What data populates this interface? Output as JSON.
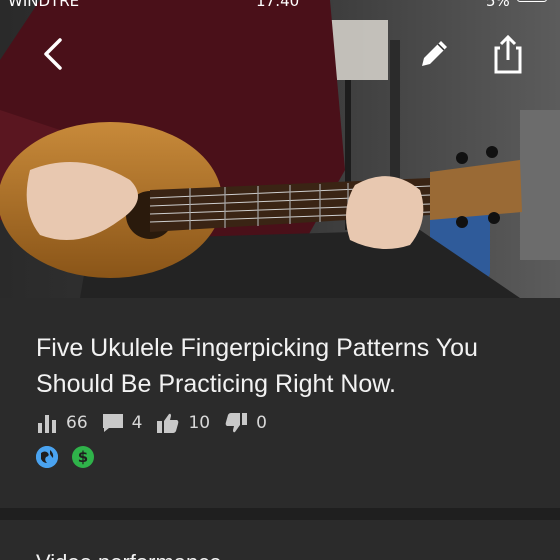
{
  "status_bar": {
    "carrier": "WINDTRE",
    "time": "17:40",
    "battery": "5%"
  },
  "video": {
    "title": "Five Ukulele Fingerpicking Patterns You Should Be Practicing Right Now.",
    "views": "66",
    "comments": "4",
    "likes": "10",
    "dislikes": "0"
  },
  "badges": {
    "monetization_symbol": "$"
  },
  "sections": {
    "performance_heading": "Video performance"
  },
  "icons": [
    "back-arrow-icon",
    "edit-pencil-icon",
    "share-icon",
    "views-bar-chart-icon",
    "comment-icon",
    "thumbs-up-icon",
    "thumbs-down-icon",
    "globe-icon",
    "dollar-icon"
  ],
  "colors": {
    "background": "#1f1f1f",
    "panel": "#2b2b2b",
    "public_badge": "#4aa3f0",
    "monetized_badge": "#2fb34a"
  }
}
